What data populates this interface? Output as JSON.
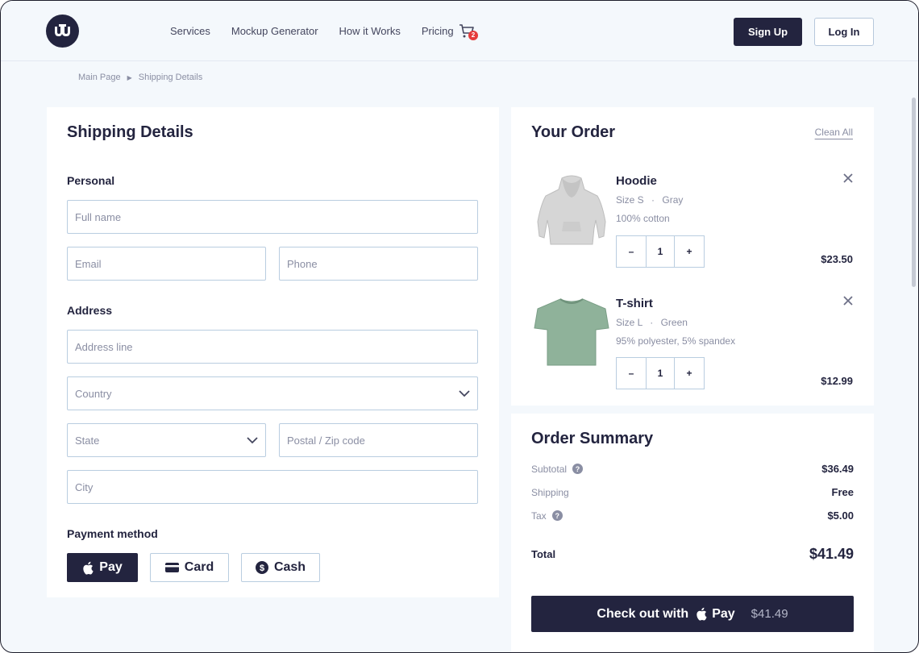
{
  "nav": {
    "items": [
      "Services",
      "Mockup Generator",
      "How it Works",
      "Pricing"
    ],
    "cart_count": "2",
    "signup_label": "Sign Up",
    "login_label": "Log In"
  },
  "breadcrumb": {
    "items": [
      "Main Page",
      "Shipping Details"
    ]
  },
  "shipping": {
    "title": "Shipping Details",
    "personal_label": "Personal",
    "fullname_placeholder": "Full name",
    "email_placeholder": "Email",
    "phone_placeholder": "Phone",
    "address_label": "Address",
    "address_placeholder": "Address line",
    "country_placeholder": "Country",
    "state_placeholder": "State",
    "postal_placeholder": "Postal / Zip code",
    "city_placeholder": "City",
    "payment_label": "Payment method",
    "payment_options": [
      "Pay",
      "Card",
      "Cash"
    ],
    "selected_payment": "Pay"
  },
  "order": {
    "title": "Your Order",
    "clean_all": "Clean All",
    "items": [
      {
        "name": "Hoodie",
        "size": "Size S",
        "color": "Gray",
        "material": "100% cotton",
        "qty": "1",
        "price": "$23.50",
        "swatch": "#d6d6d6"
      },
      {
        "name": "T-shirt",
        "size": "Size L",
        "color": "Green",
        "material": "95% polyester, 5% spandex",
        "qty": "1",
        "price": "$12.99",
        "swatch": "#8fb29a"
      }
    ],
    "dot": "·",
    "minus": "–",
    "plus": "+"
  },
  "summary": {
    "title": "Order Summary",
    "subtotal_label": "Subtotal",
    "subtotal_value": "$36.49",
    "shipping_label": "Shipping",
    "shipping_value": "Free",
    "tax_label": "Tax",
    "tax_value": "$5.00",
    "total_label": "Total",
    "total_value": "$41.49",
    "checkout_label": "Check out with",
    "checkout_pay": "Pay",
    "checkout_amount": "$41.49"
  },
  "colors": {
    "primary": "#23243f",
    "background": "#f4f8fc",
    "border": "#b9cde0",
    "muted": "#8a8ea3",
    "badge": "#e53c3c"
  }
}
